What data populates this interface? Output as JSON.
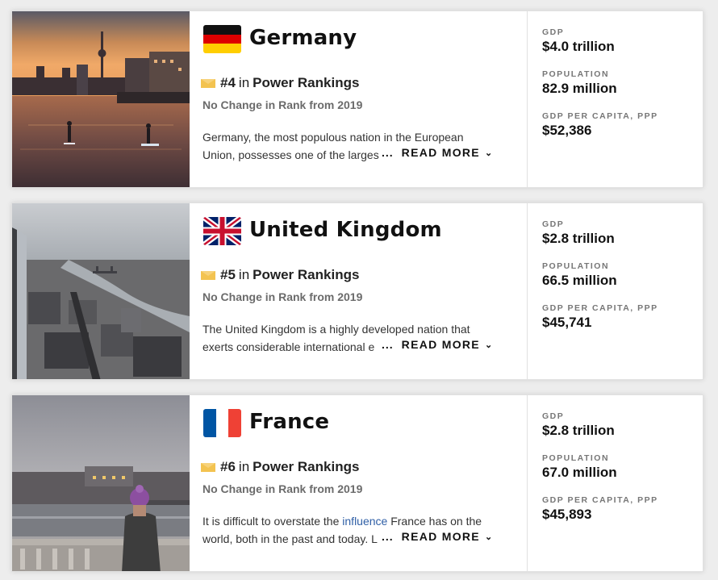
{
  "cards": [
    {
      "country": "Germany",
      "rank": "#4",
      "in_text": "in",
      "rank_list": "Power Rankings",
      "change": "No Change in Rank from 2019",
      "desc_line1": "Germany, the most populous nation in the European",
      "desc_line2": "Union, possesses one of the larges",
      "read_more": "READ MORE",
      "ellipsis": "...",
      "stats": [
        {
          "label": "GDP",
          "value": "$4.0 trillion"
        },
        {
          "label": "POPULATION",
          "value": "82.9 million"
        },
        {
          "label": "GDP PER CAPITA, PPP",
          "value": "$52,386"
        }
      ]
    },
    {
      "country": "United Kingdom",
      "rank": "#5",
      "in_text": "in",
      "rank_list": "Power Rankings",
      "change": "No Change in Rank from 2019",
      "desc_line1": "The United Kingdom is a highly developed nation that",
      "desc_line2": "exerts considerable international e",
      "read_more": "READ MORE",
      "ellipsis": "...",
      "stats": [
        {
          "label": "GDP",
          "value": "$2.8 trillion"
        },
        {
          "label": "POPULATION",
          "value": "66.5 million"
        },
        {
          "label": "GDP PER CAPITA, PPP",
          "value": "$45,741"
        }
      ]
    },
    {
      "country": "France",
      "rank": "#6",
      "in_text": "in",
      "rank_list": "Power Rankings",
      "change": "No Change in Rank from 2019",
      "desc_line1_a": "It is difficult to overstate the ",
      "desc_line1_link": "influence",
      "desc_line1_b": " France has on the",
      "desc_line2": "world, both in the past and today. L",
      "read_more": "READ MORE",
      "ellipsis": "...",
      "stats": [
        {
          "label": "GDP",
          "value": "$2.8 trillion"
        },
        {
          "label": "POPULATION",
          "value": "67.0 million"
        },
        {
          "label": "GDP PER CAPITA, PPP",
          "value": "$45,893"
        }
      ]
    }
  ],
  "icons": {
    "medal": "rank-medal-icon",
    "chevron": "chevron-down-icon"
  }
}
